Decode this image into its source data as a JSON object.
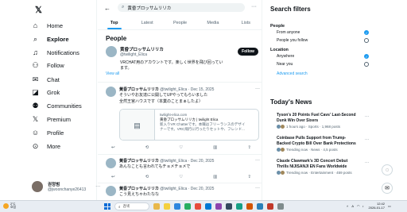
{
  "nav": {
    "logo": "𝕏",
    "items": [
      {
        "label": "Home",
        "icon": "home-icon"
      },
      {
        "label": "Explore",
        "icon": "search-icon"
      },
      {
        "label": "Notifications",
        "icon": "bell-icon"
      },
      {
        "label": "Follow",
        "icon": "follow-icon"
      },
      {
        "label": "Chat",
        "icon": "chat-icon"
      },
      {
        "label": "Grok",
        "icon": "grok-icon"
      },
      {
        "label": "Communities",
        "icon": "communities-icon"
      },
      {
        "label": "Premium",
        "icon": "premium-icon"
      },
      {
        "label": "Profile",
        "icon": "profile-icon"
      },
      {
        "label": "More",
        "icon": "more-icon"
      }
    ],
    "profile": {
      "name": "권정범",
      "handle": "@jwoonchanye26413",
      "more": "···"
    }
  },
  "search": {
    "value": "黄昏プロッサムリリカ"
  },
  "tabs": [
    "Top",
    "Latest",
    "People",
    "Media",
    "Lists"
  ],
  "people_title": "People",
  "person": {
    "name": "黄昏プロッサムリリカ",
    "handle": "@twilight_Elica",
    "bio": "VRCHAT用のアカウントです。楽しく世界を飛び回っています。",
    "follow_label": "Follow"
  },
  "view_all": "View all",
  "posts": [
    {
      "name": "黄昏プロッサムリリカ",
      "handle": "@twilight_Elica · Dec 15, 2025",
      "text1": "そういやお友達に公開してUPやってもらいました",
      "text2": "全然王宮ハウスです（本業のことまぁしたよ）",
      "card": {
        "domain": "twilight-elica.com",
        "title": "黄昏プロッサムリリカ | twilight Elica",
        "desc1": "新入りVR Chatterです。本職はフリーランスのデザイ",
        "desc2": "ナーです。VRC飛行に行ったりセットや、フレンド..."
      },
      "actions": [
        "↩",
        "⟲",
        "♡",
        "▥",
        "⇪"
      ]
    },
    {
      "name": "黄昏プロッサムリリカ",
      "handle": "@twilight_Elica · Dec 20, 2025",
      "text1": "あんなことも言われてもチョメチョメで",
      "text2": "",
      "actions": [
        "↩",
        "⟲",
        "♡",
        "▥",
        "⇪"
      ]
    },
    {
      "name": "黄昏プロッサムリリカ",
      "handle": "@twilight_Elica · Dec 20, 2025",
      "text1": "こう見えちゃわたなな",
      "text2": ""
    }
  ],
  "filters": {
    "title": "Search filters",
    "people_heading": "People",
    "people_options": [
      {
        "label": "From anyone",
        "selected": true
      },
      {
        "label": "People you follow",
        "selected": false
      }
    ],
    "location_heading": "Location",
    "location_options": [
      {
        "label": "Anywhere",
        "selected": true
      },
      {
        "label": "Near you",
        "selected": false
      }
    ],
    "advanced": "Advanced search"
  },
  "news": {
    "title": "Today's News",
    "items": [
      {
        "title": "Tyson's 20 Points Fuel Cavs' Last-Second Dunk Win Over Sixers",
        "meta": "1 hours ago · Sports · 1,968 posts"
      },
      {
        "title": "Coinbase Pulls Support from Trump-Backed Crypto Bill Over Bank Protections",
        "meta": "Trending now · News · 4,5 posts"
      },
      {
        "title": "Claude Clawmark's 3D Concert Debut Thrills NIJISANJI EN Fans Worldwide",
        "meta": "Trending now · Entertainment · 459 posts"
      }
    ]
  },
  "taskbar": {
    "weather_temp": "2°C",
    "weather_label": "흐림",
    "search_placeholder": "검색",
    "time": "12:42",
    "date": "2026-01-17",
    "lang": "A",
    "app_colors": [
      "#e8b84b",
      "#f4d03f",
      "#2e86de",
      "#27ae60",
      "#e74c3c",
      "#0078d4",
      "#8e44ad",
      "#34495e",
      "#16a085",
      "#d35400",
      "#2980b9",
      "#c0392b",
      "#7f8c8d"
    ]
  }
}
